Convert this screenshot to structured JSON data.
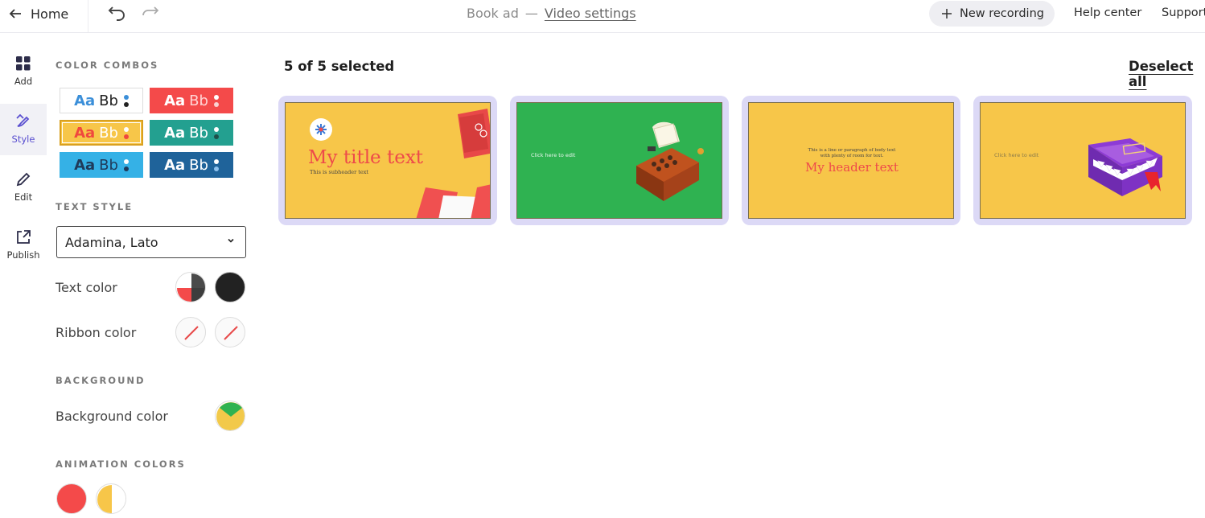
{
  "topbar": {
    "home_label": "Home",
    "project_name": "Book ad",
    "separator": "—",
    "section_link": "Video settings",
    "new_recording_label": "New recording",
    "help_label": "Help center",
    "support_label": "Support"
  },
  "rail": {
    "items": [
      {
        "label": "Add",
        "icon": "grid-icon"
      },
      {
        "label": "Style",
        "icon": "brush-icon"
      },
      {
        "label": "Edit",
        "icon": "pencil-icon"
      },
      {
        "label": "Publish",
        "icon": "share-icon"
      }
    ],
    "active": "Style"
  },
  "panel": {
    "color_combos_label": "COLOR COMBOS",
    "combo_aa": "Aa",
    "combo_bb": "Bb",
    "combos": [
      {
        "bg": "#ffffff",
        "aa": "#3b8fd9",
        "bb": "#222222",
        "dot1": "#3b8fd9",
        "dot2": "#222222"
      },
      {
        "bg": "#f44a4a",
        "aa": "#ffffff",
        "bb": "#ffd3d3",
        "dot1": "#ffffff",
        "dot2": "#f9d2d2"
      },
      {
        "bg": "#f7c649",
        "aa": "#f0483e",
        "bb": "#ffffff",
        "dot1": "#ffffff",
        "dot2": "#f0483e"
      },
      {
        "bg": "#23a090",
        "aa": "#ffffff",
        "bb": "#ffffff",
        "dot1": "#ffffff",
        "dot2": "#1f4f4a"
      },
      {
        "bg": "#35b1e6",
        "aa": "#1f3a5a",
        "bb": "#1f3a5a",
        "dot1": "#ffffff",
        "dot2": "#1f3a5a"
      },
      {
        "bg": "#1f639a",
        "aa": "#ffffff",
        "bb": "#ffffff",
        "dot1": "#ffffff",
        "dot2": "#8fc2ee"
      }
    ],
    "selected_combo": 2,
    "text_style_label": "TEXT STYLE",
    "font_value": "Adamina, Lato",
    "text_color_label": "Text color",
    "ribbon_color_label": "Ribbon color",
    "background_label": "BACKGROUND",
    "background_color_label": "Background color",
    "animation_colors_label": "ANIMATION COLORS"
  },
  "main": {
    "selection_status": "5 of 5 selected",
    "deselect_label": "Deselect all",
    "slides": [
      {
        "bg": "#f7c649",
        "title": "My title text",
        "subtitle": "This is subheader text"
      },
      {
        "bg": "#2fb251",
        "edit_hint": "Click here to edit"
      },
      {
        "bg": "#f7c649",
        "body": "This is a line or paragraph of body text with plenty of room for text.",
        "header": "My header text"
      },
      {
        "bg": "#f7c649",
        "edit_hint": "Click here to edit"
      }
    ]
  },
  "colors": {
    "accent": "#5a4fd0",
    "card_border": "#dcd9f6",
    "red": "#f44a4a",
    "yellow": "#f7c649",
    "green": "#2fb251"
  }
}
